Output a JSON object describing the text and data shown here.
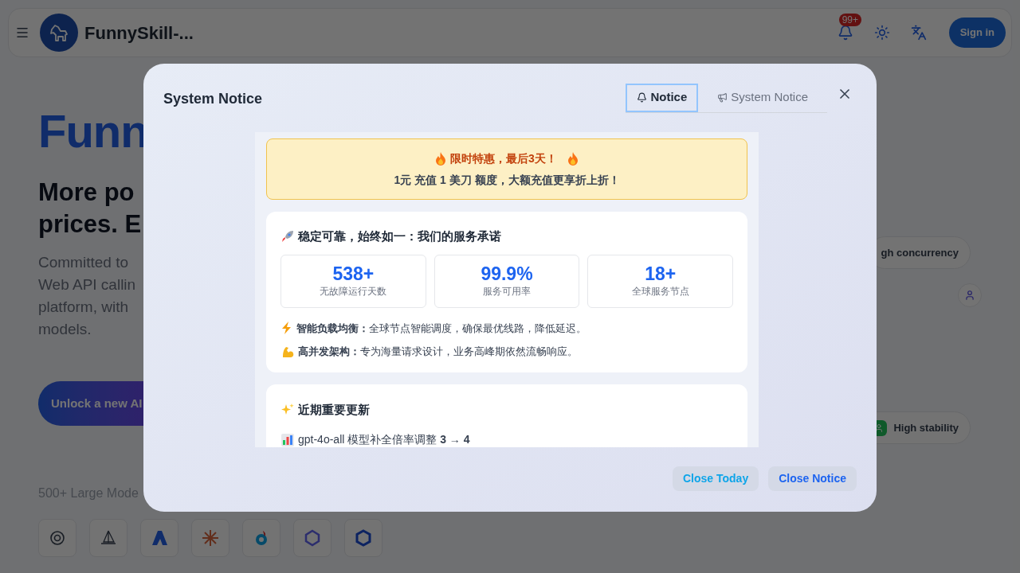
{
  "header": {
    "brand": "FunnySkill-...",
    "notification_badge": "99+",
    "sign_in": "Sign in"
  },
  "hero": {
    "title": "Funn",
    "subtitle_lines": [
      "More po",
      "prices. E"
    ],
    "description_lines": [
      "Committed to",
      "Web API callin",
      "platform, with",
      "models."
    ],
    "cta": "Unlock a new AI",
    "models_label": "500+ Large Mode"
  },
  "chips": [
    {
      "label": "gh concurrency",
      "kind": "plain"
    },
    {
      "label": "High stability",
      "kind": "icon"
    }
  ],
  "modal": {
    "title": "System Notice",
    "tabs": [
      {
        "label": "Notice",
        "selected": true
      },
      {
        "label": "System Notice",
        "selected": false
      }
    ],
    "promo": {
      "title": "限时特惠，最后3天！",
      "text": "1元 充值 1 美刀 额度，大额充值更享折上折！"
    },
    "service": {
      "heading": "稳定可靠，始终如一：我们的服务承诺",
      "stats": [
        {
          "value": "538+",
          "label": "无故障运行天数"
        },
        {
          "value": "99.9%",
          "label": "服务可用率"
        },
        {
          "value": "18+",
          "label": "全球服务节点"
        }
      ],
      "features": [
        "**智能负载均衡：**全球节点智能调度，确保最优线路，降低延迟。",
        "**高并发架构：**专为海量请求设计，业务高峰期依然流畅响应。"
      ]
    },
    "updates": {
      "heading": "近期重要更新",
      "items": [
        "gpt-4o-all 模型补全倍率调整 **3 → 4**"
      ]
    },
    "buttons": [
      "Close Today",
      "Close Notice"
    ]
  }
}
